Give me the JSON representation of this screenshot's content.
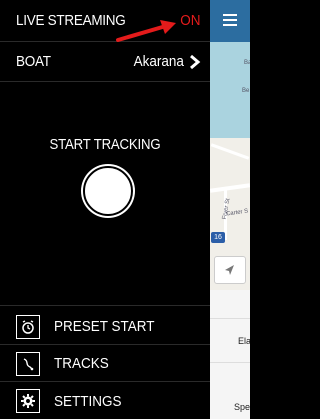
{
  "drawer": {
    "live_streaming_label": "LIVE STREAMING",
    "live_streaming_status": "ON",
    "boat_label": "BOAT",
    "boat_value": "Akarana",
    "start_tracking_label": "START TRACKING",
    "menu": [
      {
        "label": "PRESET START",
        "icon": "alarm-clock-icon"
      },
      {
        "label": "TRACKS",
        "icon": "track-path-icon"
      },
      {
        "label": "SETTINGS",
        "icon": "gear-icon"
      }
    ]
  },
  "map_panel": {
    "map_labels": [
      "Ba",
      "Be",
      "Carter S",
      "Fryer St"
    ],
    "highway_badge": "16",
    "lower_labels": [
      "Ela",
      "Spe"
    ]
  },
  "colors": {
    "status_on": "#e41b1b",
    "map_header": "#2c6da0",
    "water": "#aad3df"
  }
}
